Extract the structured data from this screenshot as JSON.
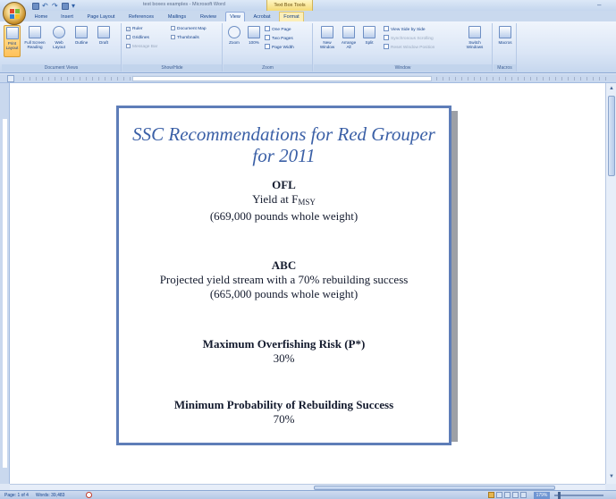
{
  "window": {
    "title": "test boxes examples - Microsoft Word",
    "context_title": "Text Box Tools"
  },
  "tabs": [
    "Home",
    "Insert",
    "Page Layout",
    "References",
    "Mailings",
    "Review",
    "View",
    "Acrobat",
    "Format"
  ],
  "active_tab": "View",
  "ribbon": {
    "document_views": {
      "label": "Document Views",
      "buttons": [
        "Print Layout",
        "Full Screen Reading",
        "Web Layout",
        "Outline",
        "Draft"
      ]
    },
    "show_hide": {
      "label": "Show/Hide",
      "ruler": "Ruler",
      "gridlines": "Gridlines",
      "message_bar": "Message Bar",
      "document_map": "Document Map",
      "thumbnails": "Thumbnails"
    },
    "zoom": {
      "label": "Zoom",
      "zoom_btn": "Zoom",
      "hundred": "100%",
      "one_page": "One Page",
      "two_pages": "Two Pages",
      "page_width": "Page Width"
    },
    "window": {
      "label": "Window",
      "new_window": "New Window",
      "arrange_all": "Arrange All",
      "split": "Split",
      "side_by_side": "View Side by Side",
      "sync_scroll": "Synchronous Scrolling",
      "reset_pos": "Reset Window Position",
      "switch_windows": "Switch Windows"
    },
    "macros": {
      "label": "Macros",
      "button": "Macros"
    }
  },
  "document": {
    "title_line1": "SSC Recommendations for Red Grouper",
    "title_line2": "for 2011",
    "ofl": {
      "head": "OFL",
      "line1": "Yield at F",
      "sub": "MSY",
      "line2": "(669,000 pounds whole weight)"
    },
    "abc": {
      "head": "ABC",
      "line1": "Projected yield stream with a 70% rebuilding success",
      "line2": "(665,000 pounds whole weight)"
    },
    "risk": {
      "head": "Maximum Overfishing Risk (P*)",
      "value": "30%"
    },
    "rebuild": {
      "head": "Minimum Probability of Rebuilding Success",
      "value": "70%"
    }
  },
  "status": {
    "page": "Page: 1 of 4",
    "words": "Words: 39,483",
    "zoom": "179%"
  }
}
